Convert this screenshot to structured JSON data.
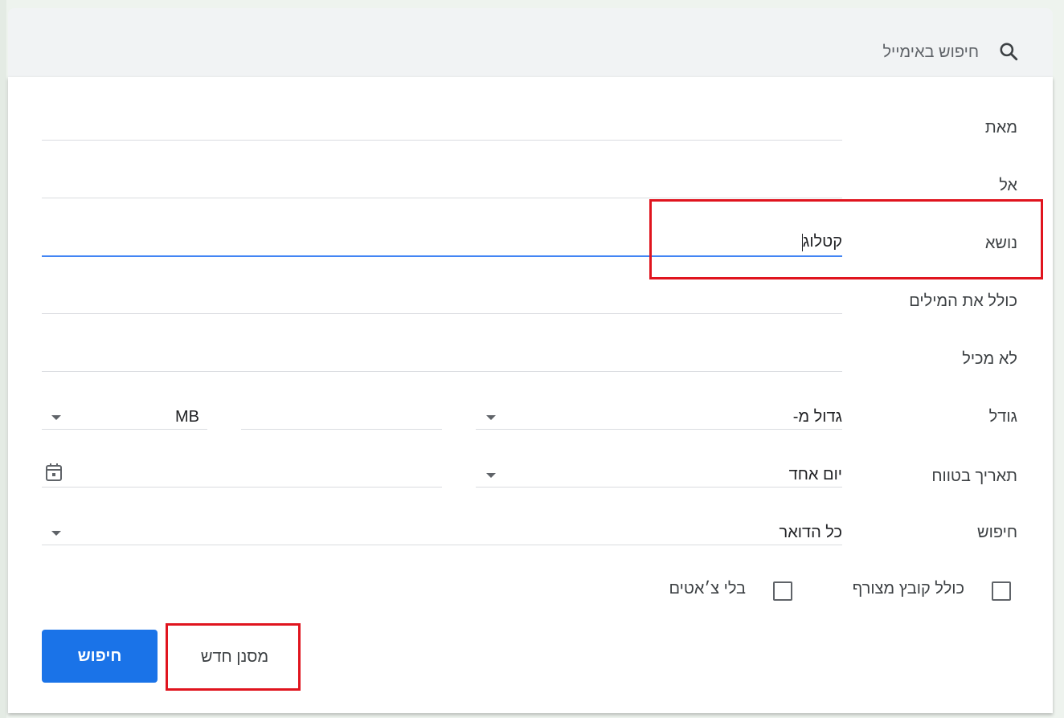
{
  "search": {
    "placeholder": "חיפוש באימייל"
  },
  "form": {
    "from_label": "מאת",
    "to_label": "אל",
    "subject_label": "נושא",
    "subject_value": "קטלוג",
    "has_words_label": "כולל את המילים",
    "doesnt_have_label": "לא מכיל",
    "size_label": "גודל",
    "size_operator": "גדול מ-",
    "size_unit": "MB",
    "date_label": "תאריך בטווח",
    "date_range": "יום אחד",
    "search_in_label": "חיפוש",
    "search_in_value": "כל הדואר",
    "has_attachment_label": "כולל קובץ מצורף",
    "no_chats_label": "בלי צ׳אטים"
  },
  "buttons": {
    "search": "חיפוש",
    "create_filter": "מסנן חדש"
  },
  "colors": {
    "accent": "#1a73e8",
    "active_underline": "#4285f4",
    "highlight_box": "#e0141e"
  },
  "icons": {
    "search": "search-icon",
    "dropdown": "chevron-down-icon",
    "calendar": "calendar-icon"
  }
}
